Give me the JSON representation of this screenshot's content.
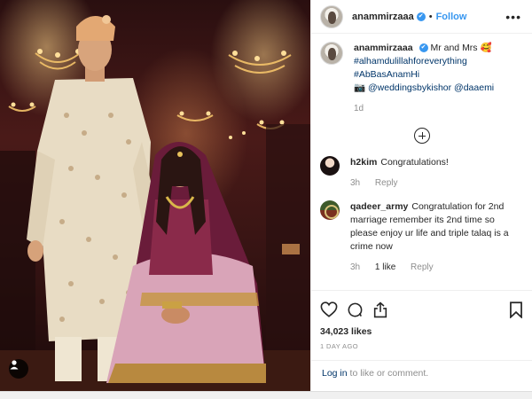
{
  "post": {
    "author": "anammirzaaa",
    "verified_mark": "✔",
    "separator": "•",
    "follow_label": "Follow",
    "more_label": "•••"
  },
  "caption": {
    "author": "anammirzaaa",
    "line1": "Mr and Mrs 🥰",
    "line2": "#alhamdulillahforeverything",
    "line3": "#AbBasAnamHi",
    "camera_emoji": "📷",
    "credit1": "@weddingsbykishor",
    "credit2": "@daaemi",
    "time": "1d"
  },
  "comments": [
    {
      "user": "h2kim",
      "text": "Congratulations!",
      "time": "3h",
      "likes": "",
      "reply": "Reply"
    },
    {
      "user": "qadeer_army",
      "text": "Congratulation for 2nd marriage remember its 2nd time so please enjoy ur life and triple talaq is a crime now",
      "time": "3h",
      "likes": "1 like",
      "reply": "Reply"
    }
  ],
  "icons": {
    "like": "heart-icon",
    "comment": "comment-icon",
    "share": "share-icon",
    "save": "bookmark-icon",
    "load_more": "plus-circle-icon",
    "tagged_users": "user-icon"
  },
  "likes": "34,023 likes",
  "date": "1 DAY AGO",
  "login": {
    "link": "Log in",
    "rest": " to like or comment."
  },
  "colors": {
    "link_blue": "#3897f0",
    "tag_blue": "#003569",
    "muted": "#8e8e8e",
    "text": "#262626"
  }
}
